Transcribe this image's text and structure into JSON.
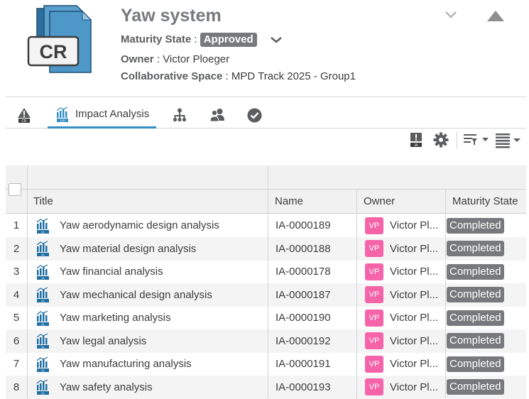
{
  "header": {
    "title": "Yaw system",
    "icon_text": "CR",
    "maturity_label": "Maturity State",
    "maturity_value": "Approved",
    "owner_label": "Owner",
    "owner_value": "Victor Ploeger",
    "space_label": "Collaborative Space",
    "space_value": "MPD Track 2025 - Group1",
    "separator": " : "
  },
  "tabs": [
    {
      "label": "",
      "icon": "change-request-tab-icon"
    },
    {
      "label": "Impact Analysis",
      "icon": "impact-analysis-tab-icon"
    },
    {
      "label": "",
      "icon": "hierarchy-tab-icon"
    },
    {
      "label": "",
      "icon": "members-tab-icon"
    },
    {
      "label": "",
      "icon": "approval-tab-icon"
    }
  ],
  "toolbar": {
    "icons": [
      "new-impact-analysis-icon",
      "settings-icon",
      "filter-dropdown-icon",
      "view-mode-dropdown-icon"
    ]
  },
  "grid": {
    "columns": {
      "title": "Title",
      "name": "Name",
      "owner": "Owner",
      "state": "Maturity State"
    },
    "rows": [
      {
        "num": "1",
        "title": "Yaw aerodynamic design analysis",
        "name": "IA-0000189",
        "initials": "VP",
        "owner": "Victor Pl...",
        "state": "Completed"
      },
      {
        "num": "2",
        "title": "Yaw material design analysis",
        "name": "IA-0000188",
        "initials": "VP",
        "owner": "Victor Pl...",
        "state": "Completed"
      },
      {
        "num": "3",
        "title": "Yaw financial analysis",
        "name": "IA-0000178",
        "initials": "VP",
        "owner": "Victor Pl...",
        "state": "Completed"
      },
      {
        "num": "4",
        "title": "Yaw mechanical design analysis",
        "name": "IA-0000187",
        "initials": "VP",
        "owner": "Victor Pl...",
        "state": "Completed"
      },
      {
        "num": "5",
        "title": "Yaw marketing analysis",
        "name": "IA-0000190",
        "initials": "VP",
        "owner": "Victor Pl...",
        "state": "Completed"
      },
      {
        "num": "6",
        "title": "Yaw legal analysis",
        "name": "IA-0000192",
        "initials": "VP",
        "owner": "Victor Pl...",
        "state": "Completed"
      },
      {
        "num": "7",
        "title": "Yaw manufacturing analysis",
        "name": "IA-0000191",
        "initials": "VP",
        "owner": "Victor Pl...",
        "state": "Completed"
      },
      {
        "num": "8",
        "title": "Yaw safety analysis",
        "name": "IA-0000193",
        "initials": "VP",
        "owner": "Victor Pl...",
        "state": "Completed"
      }
    ]
  },
  "colors": {
    "accent": "#368ec4",
    "badge_gray": "#77797c",
    "avatar_pink": "#f564a9"
  }
}
